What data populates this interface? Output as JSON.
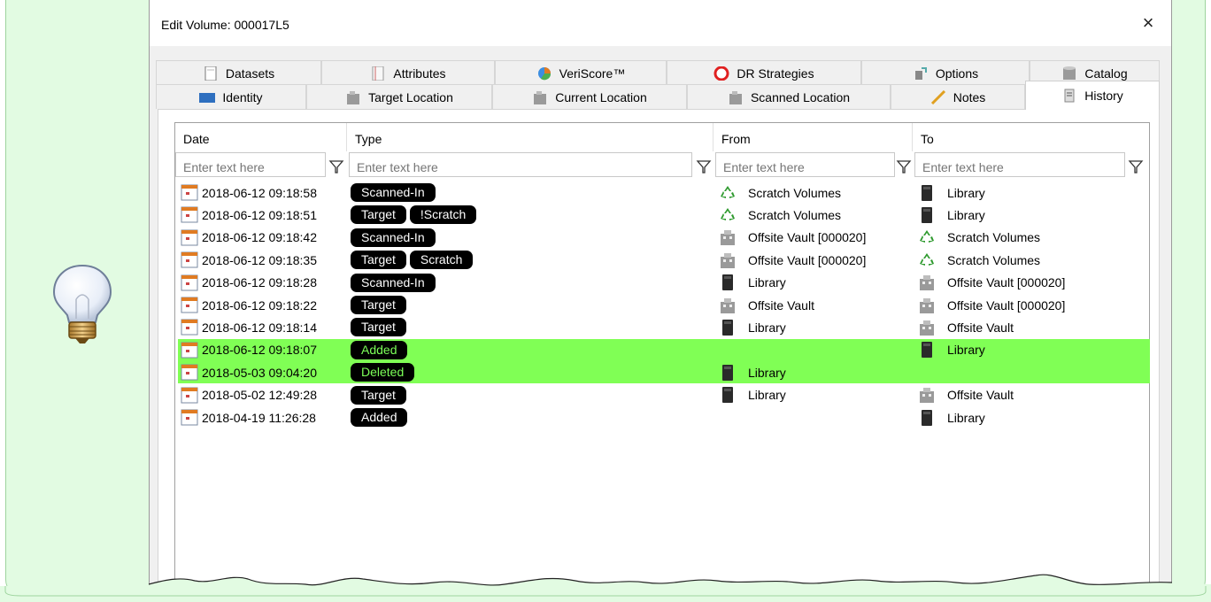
{
  "dialog": {
    "title": "Edit Volume: 000017L5",
    "close_label": "×"
  },
  "tabs": {
    "row1": [
      {
        "label": "Datasets",
        "icon": "document-icon"
      },
      {
        "label": "Attributes",
        "icon": "note-icon"
      },
      {
        "label": "VeriScore™",
        "icon": "pie-chart-icon"
      },
      {
        "label": "DR Strategies",
        "icon": "lifebuoy-icon"
      },
      {
        "label": "Options",
        "icon": "options-icon"
      },
      {
        "label": "Catalog",
        "icon": "database-icon"
      }
    ],
    "row2": [
      {
        "label": "Identity",
        "icon": "tape-icon"
      },
      {
        "label": "Target Location",
        "icon": "building-icon"
      },
      {
        "label": "Current Location",
        "icon": "building-icon"
      },
      {
        "label": "Scanned Location",
        "icon": "building-icon"
      },
      {
        "label": "Notes",
        "icon": "pencil-icon"
      },
      {
        "label": "History",
        "icon": "history-icon",
        "active": true
      }
    ]
  },
  "grid": {
    "columns": [
      {
        "header": "Date",
        "filter_placeholder": "Enter text here"
      },
      {
        "header": "Type",
        "filter_placeholder": "Enter text here"
      },
      {
        "header": "From",
        "filter_placeholder": "Enter text here"
      },
      {
        "header": "To",
        "filter_placeholder": "Enter text here"
      }
    ],
    "rows": [
      {
        "date": "2018-06-12 09:18:58",
        "types": [
          "Scanned-In"
        ],
        "from": {
          "text": "Scratch Volumes",
          "icon": "recycle-icon"
        },
        "to": {
          "text": "Library",
          "icon": "library-icon"
        },
        "highlight": false
      },
      {
        "date": "2018-06-12 09:18:51",
        "types": [
          "Target",
          "!Scratch"
        ],
        "from": {
          "text": "Scratch Volumes",
          "icon": "recycle-icon"
        },
        "to": {
          "text": "Library",
          "icon": "library-icon"
        },
        "highlight": false
      },
      {
        "date": "2018-06-12 09:18:42",
        "types": [
          "Scanned-In"
        ],
        "from": {
          "text": "Offsite Vault [000020]",
          "icon": "building-icon"
        },
        "to": {
          "text": "Scratch Volumes",
          "icon": "recycle-icon"
        },
        "highlight": false
      },
      {
        "date": "2018-06-12 09:18:35",
        "types": [
          "Target",
          "Scratch"
        ],
        "from": {
          "text": "Offsite Vault [000020]",
          "icon": "building-icon"
        },
        "to": {
          "text": "Scratch Volumes",
          "icon": "recycle-icon"
        },
        "highlight": false
      },
      {
        "date": "2018-06-12 09:18:28",
        "types": [
          "Scanned-In"
        ],
        "from": {
          "text": "Library",
          "icon": "library-icon"
        },
        "to": {
          "text": "Offsite Vault [000020]",
          "icon": "building-icon"
        },
        "highlight": false
      },
      {
        "date": "2018-06-12 09:18:22",
        "types": [
          "Target"
        ],
        "from": {
          "text": "Offsite Vault",
          "icon": "building-icon"
        },
        "to": {
          "text": "Offsite Vault [000020]",
          "icon": "building-icon"
        },
        "highlight": false
      },
      {
        "date": "2018-06-12 09:18:14",
        "types": [
          "Target"
        ],
        "from": {
          "text": "Library",
          "icon": "library-icon"
        },
        "to": {
          "text": "Offsite Vault",
          "icon": "building-icon"
        },
        "highlight": false
      },
      {
        "date": "2018-06-12 09:18:07",
        "types": [
          "Added"
        ],
        "from": null,
        "to": {
          "text": "Library",
          "icon": "library-icon"
        },
        "highlight": true
      },
      {
        "date": "2018-05-03 09:04:20",
        "types": [
          "Deleted"
        ],
        "from": {
          "text": "Library",
          "icon": "library-icon"
        },
        "to": null,
        "highlight": true
      },
      {
        "date": "2018-05-02 12:49:28",
        "types": [
          "Target"
        ],
        "from": {
          "text": "Library",
          "icon": "library-icon"
        },
        "to": {
          "text": "Offsite Vault",
          "icon": "building-icon"
        },
        "highlight": false
      },
      {
        "date": "2018-04-19 11:26:28",
        "types": [
          "Added"
        ],
        "from": null,
        "to": {
          "text": "Library",
          "icon": "library-icon"
        },
        "highlight": false
      }
    ]
  },
  "colors": {
    "highlight_row": "#80ff55",
    "badge_bg": "#000000",
    "badge_text": "#ffffff",
    "badge_text_highlight": "#7cff58",
    "callout_bg": "#e2fbe2"
  }
}
